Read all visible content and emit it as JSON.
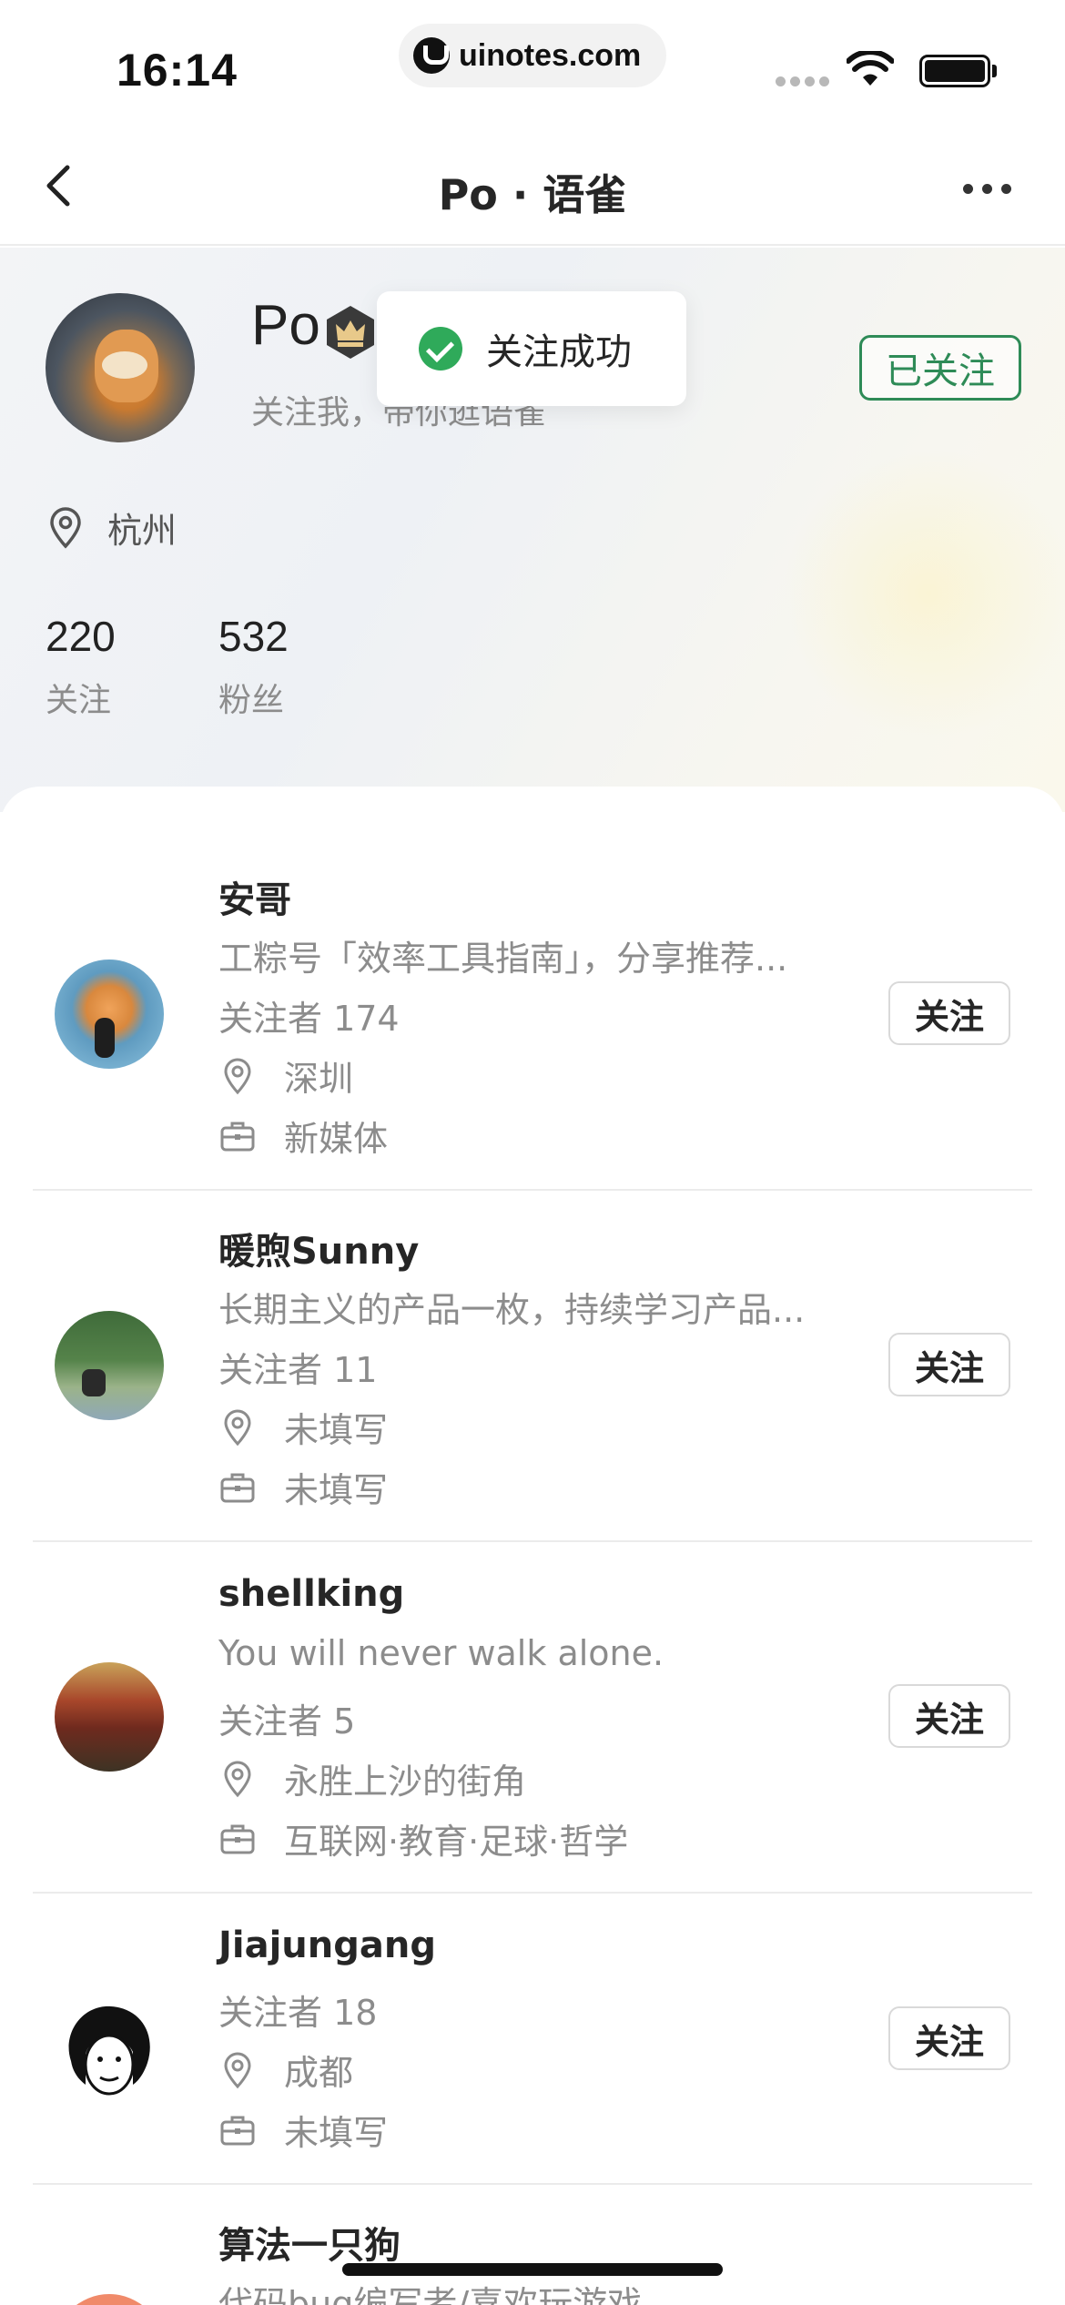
{
  "status_bar": {
    "time": "16:14",
    "url": "uinotes.com"
  },
  "nav": {
    "title": "Po · 语雀"
  },
  "profile": {
    "name": "Po",
    "bio": "关注我，带你逛语雀",
    "follow_state": "已关注",
    "location": "杭州",
    "following_count": "220",
    "following_label": "关注",
    "followers_count": "532",
    "followers_label": "粉丝"
  },
  "toast": {
    "text": "关注成功"
  },
  "users": [
    {
      "name": "安哥",
      "desc": "工粽号「效率工具指南」，分享推荐...",
      "followers": "关注者 174",
      "location": "深圳",
      "industry": "新媒体",
      "button": "关注"
    },
    {
      "name": "暖煦Sunny",
      "desc": "长期主义的产品一枚，持续学习产品...",
      "followers": "关注者 11",
      "location": "未填写",
      "industry": "未填写",
      "button": "关注"
    },
    {
      "name": "shellking",
      "desc": "You will never walk alone.",
      "followers": "关注者 5",
      "location": "永胜上沙的街角",
      "industry": "互联网·教育·足球·哲学",
      "button": "关注"
    },
    {
      "name": "Jiajungang",
      "followers": "关注者 18",
      "location": "成都",
      "industry": "未填写",
      "button": "关注"
    },
    {
      "name": "算法一只狗",
      "desc": "代码bug编写者/喜欢玩游戏"
    }
  ]
}
